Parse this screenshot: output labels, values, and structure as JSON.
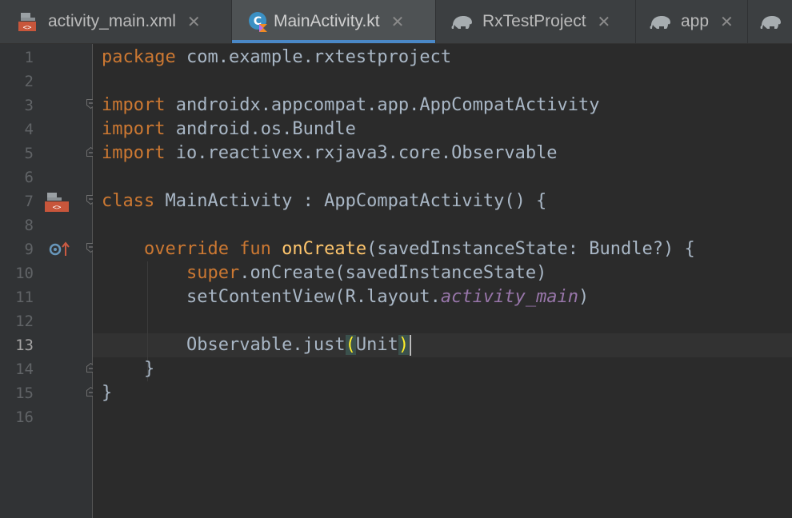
{
  "tabs": [
    {
      "label": "activity_main.xml",
      "close": "✕",
      "icon": "layout-xml-icon"
    },
    {
      "label": "MainActivity.kt",
      "close": "✕",
      "icon": "kotlin-file-icon",
      "active": true
    },
    {
      "label": "RxTestProject",
      "close": "✕",
      "icon": "gradle-elephant-icon"
    },
    {
      "label": "app",
      "close": "✕",
      "icon": "gradle-elephant-icon"
    }
  ],
  "colors": {
    "background": "#2b2b2b",
    "gutter": "#313335",
    "keyword": "#cc7832",
    "function": "#ffc66d",
    "text": "#a9b7c6",
    "property": "#9876aa",
    "tab_accent": "#4a88c7"
  },
  "editor": {
    "current_line": 13,
    "line_numbers": [
      "1",
      "2",
      "3",
      "4",
      "5",
      "6",
      "7",
      "8",
      "9",
      "10",
      "11",
      "12",
      "13",
      "14",
      "15",
      "16"
    ],
    "code": {
      "l1_kw": "package",
      "l1_text": " com.example.rxtestproject",
      "l3_kw": "import",
      "l3_text": " androidx.appcompat.app.AppCompatActivity",
      "l4_kw": "import",
      "l4_text": " android.os.Bundle",
      "l5_kw": "import",
      "l5_text": " io.reactivex.rxjava3.core.Observable",
      "l7_kw": "class",
      "l7_text": " MainActivity : AppCompatActivity() {",
      "l9_indent": "    ",
      "l9_kw": "override fun ",
      "l9_fn": "onCreate",
      "l9_text": "(savedInstanceState: Bundle?) {",
      "l10_indent": "        ",
      "l10_kw": "super",
      "l10_text": ".onCreate(savedInstanceState)",
      "l11_indent": "        ",
      "l11_text": "setContentView(R.layout.",
      "l11_prop": "activity_main",
      "l11_end": ")",
      "l13_indent": "        ",
      "l13_text": "Observable.just",
      "l13_open": "(",
      "l13_arg": "Unit",
      "l13_close": ")",
      "l14_text": "    }",
      "l15_text": "}"
    },
    "gutter_icons": [
      {
        "line": 7,
        "icon": "android-activity-layout-icon"
      },
      {
        "line": 9,
        "icon": "override-method-icon"
      }
    ]
  }
}
